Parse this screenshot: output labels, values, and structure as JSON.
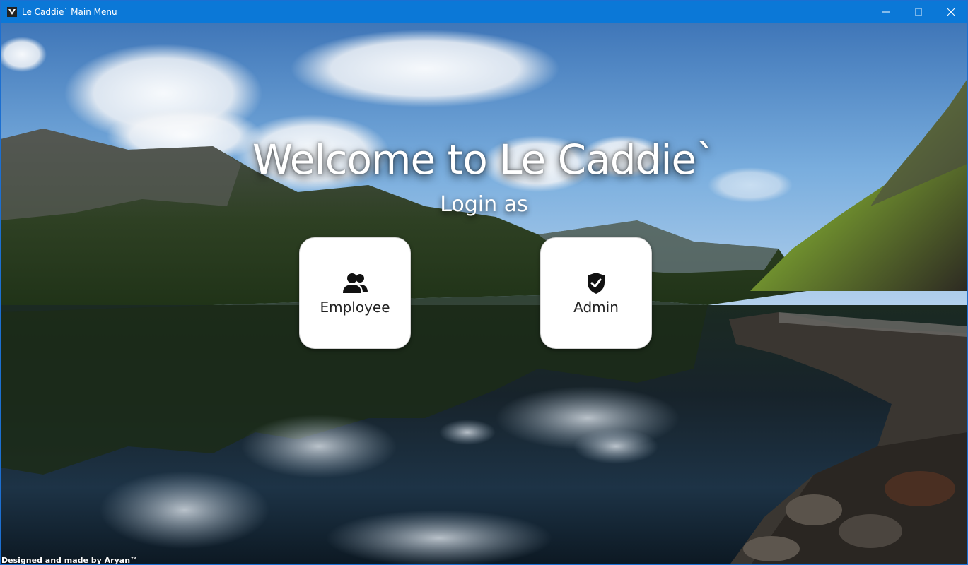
{
  "window": {
    "title": "Le Caddie` Main Menu",
    "titlebar_color": "#0b78d7"
  },
  "main": {
    "heading": "Welcome to Le Caddie`",
    "subheading": "Login as",
    "tiles": [
      {
        "label": "Employee",
        "icon": "users-icon"
      },
      {
        "label": "Admin",
        "icon": "shield-check-icon"
      }
    ]
  },
  "footer": {
    "credit": "Designed and made by Aryan™"
  },
  "background": {
    "scene": "mountain-lake-landscape",
    "sky_color": "#6fa4d8",
    "water_color": "#0f1e2a"
  }
}
